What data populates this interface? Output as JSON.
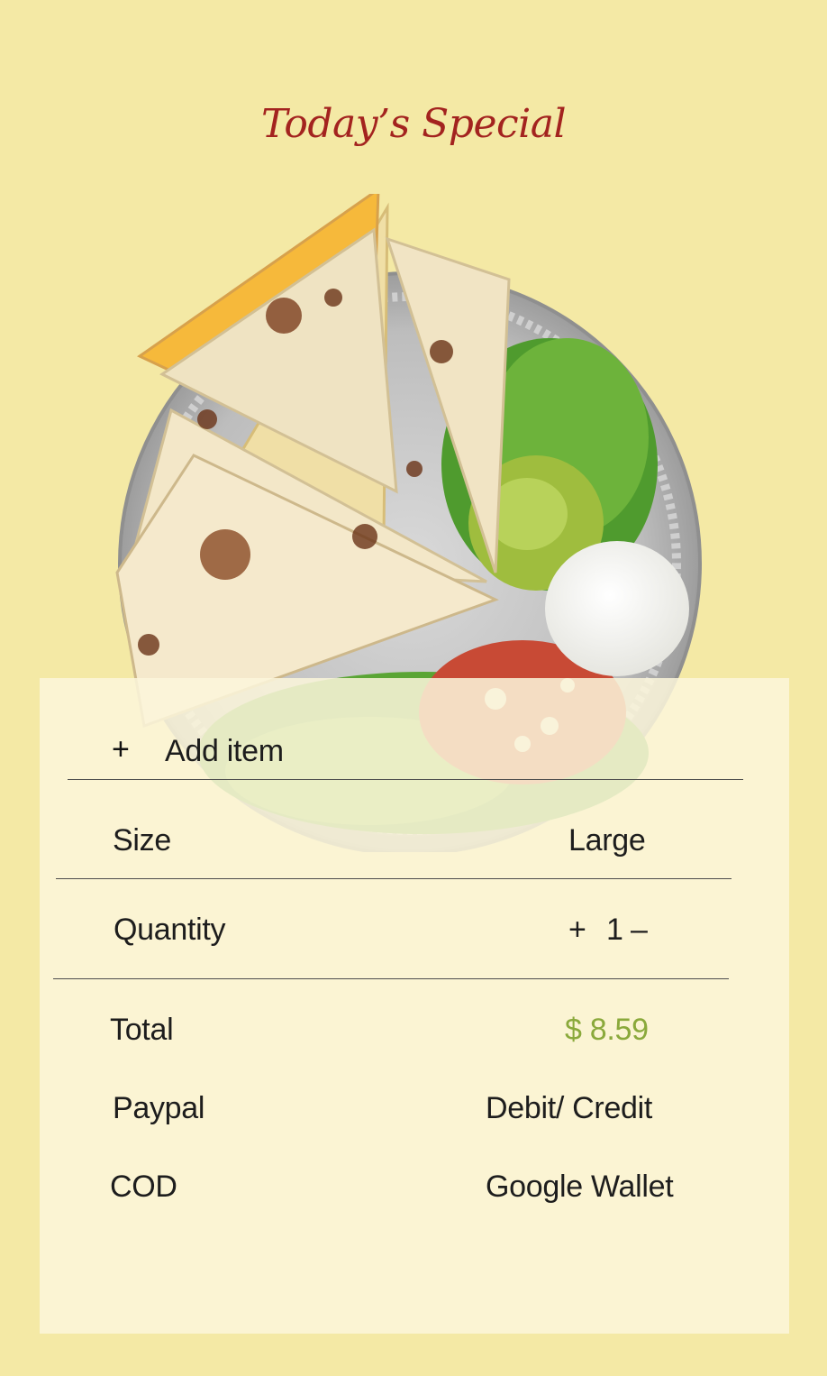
{
  "header": {
    "title": "Today’s Special"
  },
  "dish_image": {
    "description_icon": "quesadilla-plate-image"
  },
  "order": {
    "add_item_icon": "+",
    "add_item_label": "Add item",
    "size_label": "Size",
    "size_value": "Large",
    "quantity_label": "Quantity",
    "quantity_increase": "+",
    "quantity_value": "1",
    "quantity_decrease": "–",
    "total_label": "Total",
    "total_value": "$ 8.59"
  },
  "payment": {
    "options": [
      "Paypal",
      "Debit/ Credit",
      "COD",
      "Google Wallet"
    ]
  },
  "colors": {
    "background": "#f4e9a5",
    "title": "#a3231f",
    "price": "#8aa93b",
    "card": "#fcf6db"
  }
}
